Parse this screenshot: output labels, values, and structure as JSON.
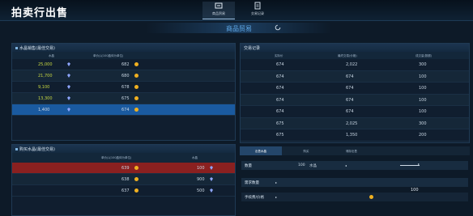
{
  "title": "拍卖行出售",
  "nav": {
    "items": [
      {
        "label": "商品贸易",
        "icon": "trade-icon",
        "active": true
      },
      {
        "label": "交易记录",
        "icon": "record-icon",
        "active": false
      }
    ]
  },
  "section_title": "商品贸易",
  "sell_panel": {
    "title": "水晶销售(最佳交易)",
    "header_qty": "水晶",
    "header_price": "单价(以100晶体为单位)",
    "rows": [
      {
        "qty": "25,000",
        "price": "682"
      },
      {
        "qty": "21,700",
        "price": "680"
      },
      {
        "qty": "9,100",
        "price": "678"
      },
      {
        "qty": "13,300",
        "price": "675"
      },
      {
        "qty": "1,400",
        "price": "674"
      }
    ]
  },
  "buy_panel": {
    "title": "购买水晶(最佳交易)",
    "header_price": "单价(以100晶体为单位)",
    "header_qty": "水晶",
    "rows": [
      {
        "price": "639",
        "qty": "100"
      },
      {
        "price": "638",
        "qty": "900"
      },
      {
        "price": "637",
        "qty": "500"
      }
    ]
  },
  "record_panel": {
    "title": "交易记录",
    "headers": [
      "实际价",
      "最终交易(价格)",
      "成交量(数额)"
    ],
    "rows": [
      [
        "674",
        "2,022",
        "300"
      ],
      [
        "674",
        "674",
        "100"
      ],
      [
        "674",
        "674",
        "100"
      ],
      [
        "674",
        "674",
        "100"
      ],
      [
        "674",
        "674",
        "100"
      ],
      [
        "675",
        "2,025",
        "300"
      ],
      [
        "675",
        "1,350",
        "200"
      ]
    ]
  },
  "tabs": [
    "出售水晶",
    "购买",
    "储存出售"
  ],
  "form": {
    "qty_label": "数量",
    "qty_value": "100",
    "qty_unit": "水晶",
    "price_label": "需求数量",
    "price_value": "100",
    "fee_label": "手续费/价格"
  },
  "colors": {
    "accent": "#5fa9e8",
    "selected_row": "#1a5aa0",
    "buy_highlight": "#8a2020",
    "gold": "#f0b020",
    "sell_qty": "#c8d840"
  }
}
